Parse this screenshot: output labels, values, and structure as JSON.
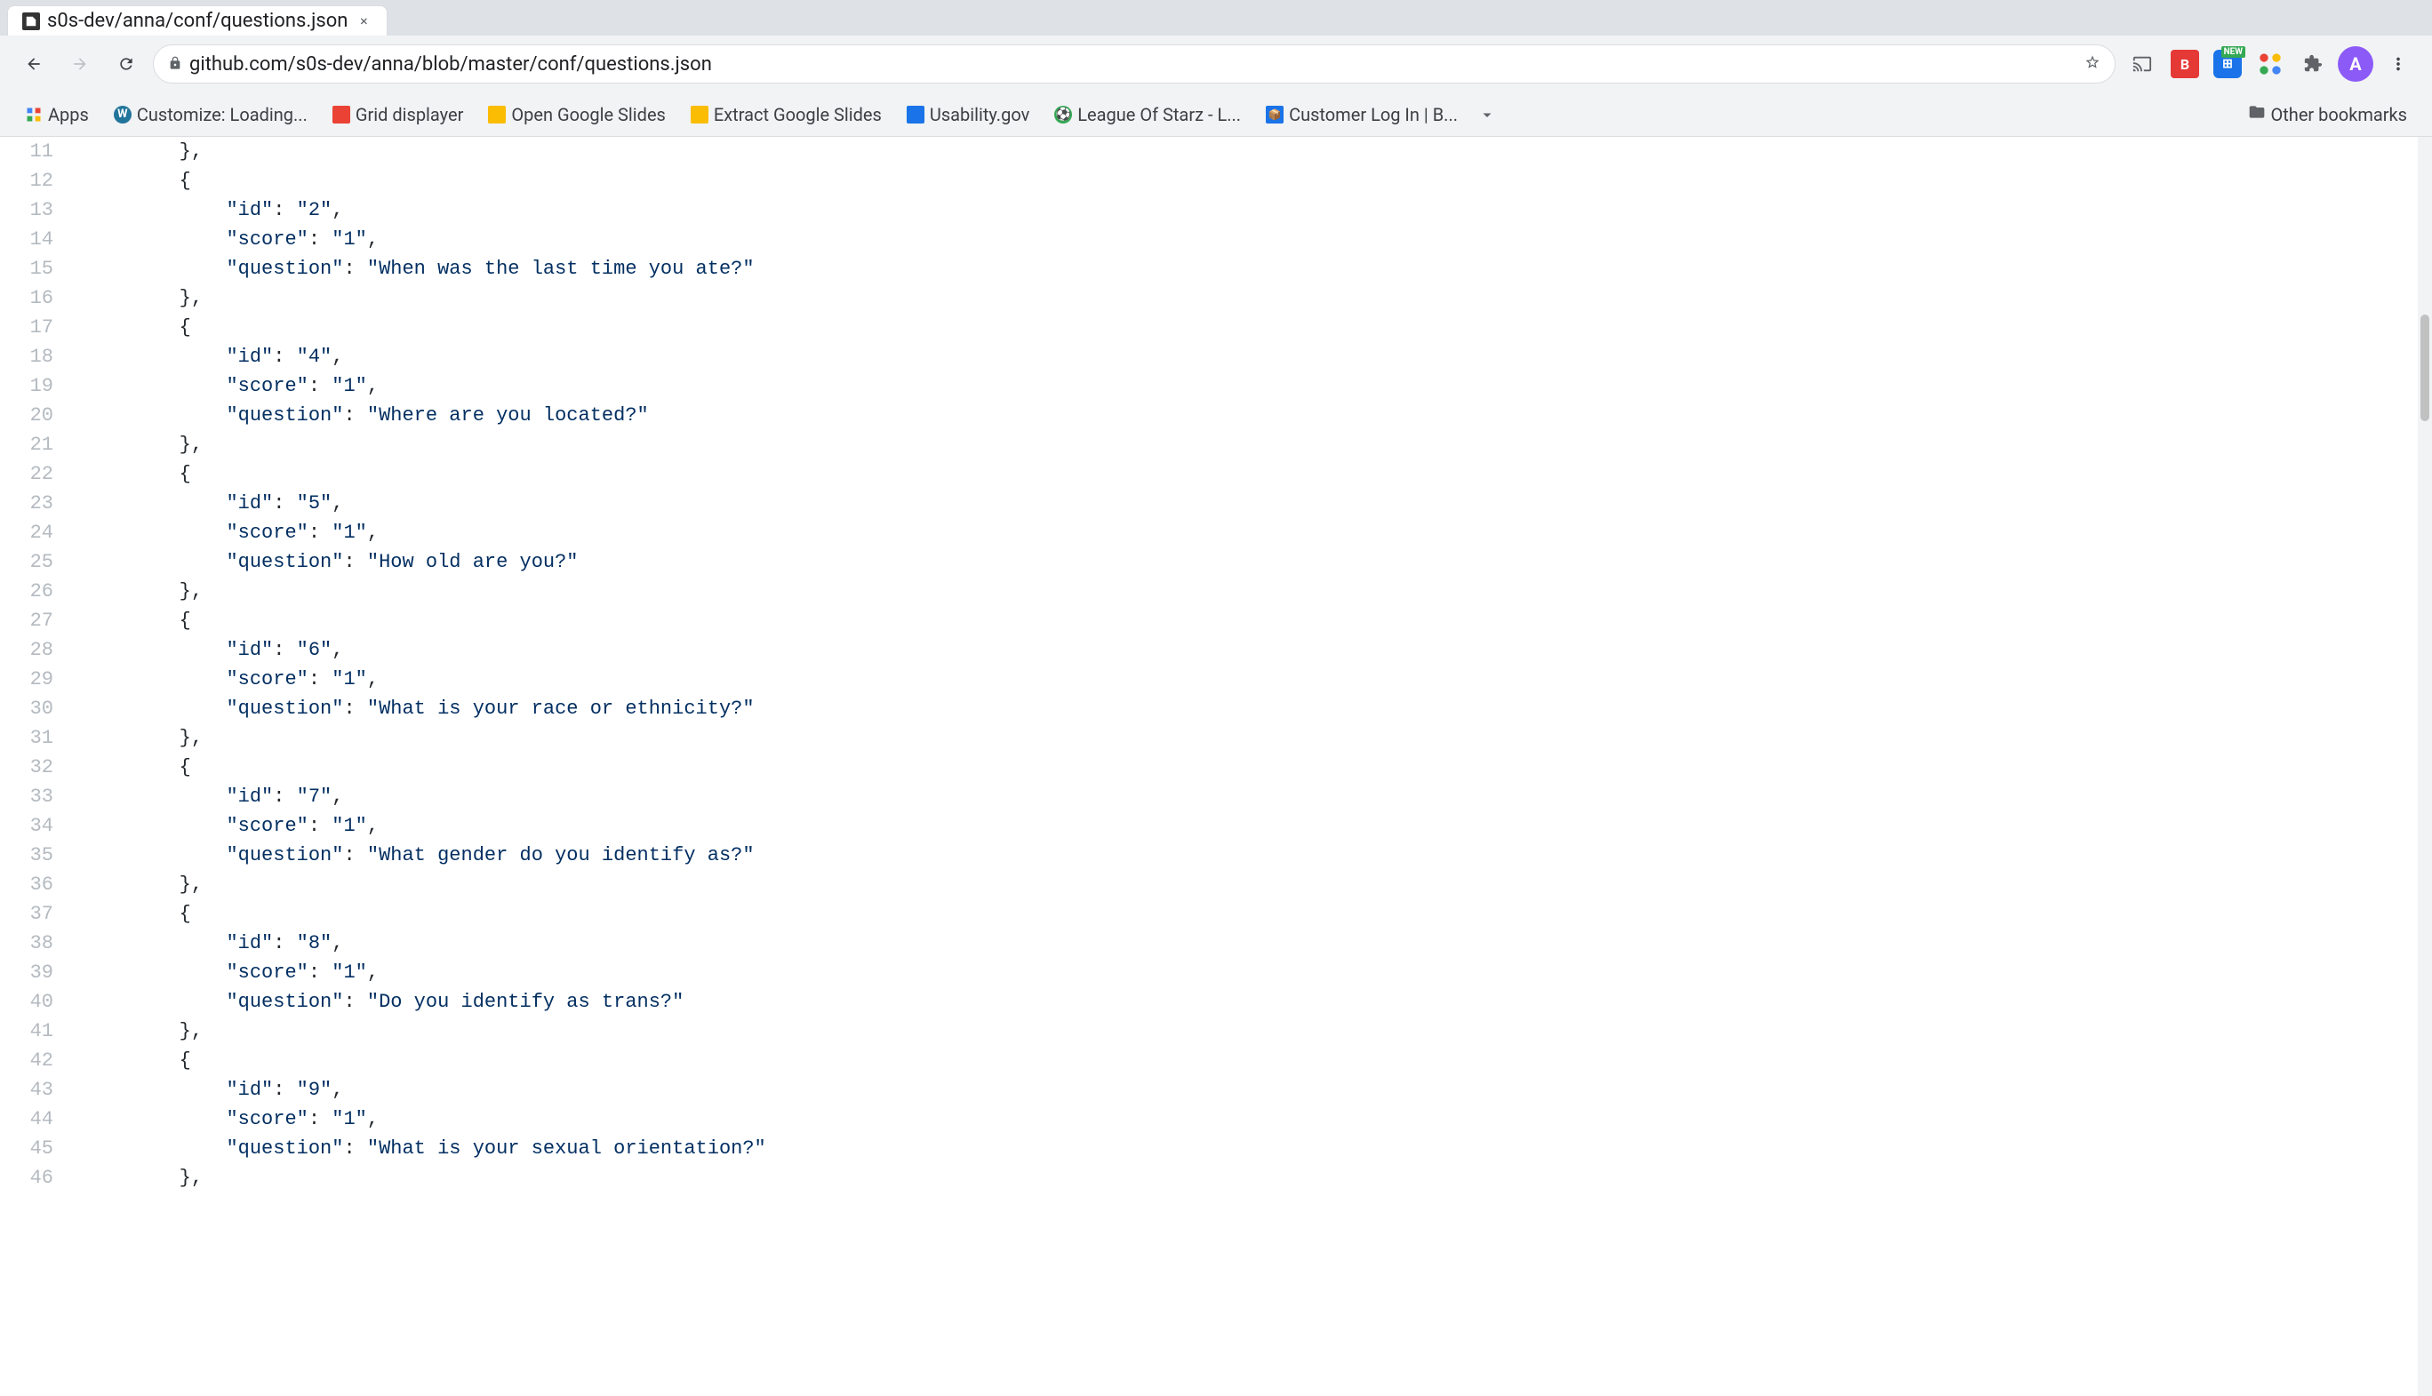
{
  "browser": {
    "tab": {
      "title": "s0s-dev/anna/conf/questions.json",
      "favicon": "📄"
    },
    "address": "github.com/s0s-dev/anna/blob/master/conf/questions.json",
    "nav": {
      "back_disabled": false,
      "forward_disabled": true,
      "reload": "↻"
    }
  },
  "bookmarks": [
    {
      "id": "apps",
      "label": "Apps",
      "favicon": "⊞",
      "color": "#4285f4"
    },
    {
      "id": "wordpress",
      "label": "Customize: Loading...",
      "favicon": "W",
      "color": "#21759b"
    },
    {
      "id": "grid",
      "label": "Grid displayer",
      "favicon": "🔴",
      "color": "#ea4335"
    },
    {
      "id": "google-slides",
      "label": "Open Google Slides",
      "favicon": "🟡",
      "color": "#fbbc04"
    },
    {
      "id": "extract-slides",
      "label": "Extract Google Slides",
      "favicon": "🟡",
      "color": "#fbbc04"
    },
    {
      "id": "usability",
      "label": "Usability.gov",
      "favicon": "🔵",
      "color": "#1a73e8"
    },
    {
      "id": "league",
      "label": "League Of Starz - L...",
      "favicon": "⚽",
      "color": "#34a853"
    },
    {
      "id": "customer",
      "label": "Customer Log In | B...",
      "favicon": "📦",
      "color": "#1a73e8"
    }
  ],
  "code": {
    "lines": [
      {
        "num": 11,
        "content": "        },"
      },
      {
        "num": 12,
        "content": "        {"
      },
      {
        "num": 13,
        "content": "            \"id\": \"2\","
      },
      {
        "num": 14,
        "content": "            \"score\": \"1\","
      },
      {
        "num": 15,
        "content": "            \"question\": \"When was the last time you ate?\""
      },
      {
        "num": 16,
        "content": "        },"
      },
      {
        "num": 17,
        "content": "        {"
      },
      {
        "num": 18,
        "content": "            \"id\": \"4\","
      },
      {
        "num": 19,
        "content": "            \"score\": \"1\","
      },
      {
        "num": 20,
        "content": "            \"question\": \"Where are you located?\""
      },
      {
        "num": 21,
        "content": "        },"
      },
      {
        "num": 22,
        "content": "        {"
      },
      {
        "num": 23,
        "content": "            \"id\": \"5\","
      },
      {
        "num": 24,
        "content": "            \"score\": \"1\","
      },
      {
        "num": 25,
        "content": "            \"question\": \"How old are you?\""
      },
      {
        "num": 26,
        "content": "        },"
      },
      {
        "num": 27,
        "content": "        {"
      },
      {
        "num": 28,
        "content": "            \"id\": \"6\","
      },
      {
        "num": 29,
        "content": "            \"score\": \"1\","
      },
      {
        "num": 30,
        "content": "            \"question\": \"What is your race or ethnicity?\""
      },
      {
        "num": 31,
        "content": "        },"
      },
      {
        "num": 32,
        "content": "        {"
      },
      {
        "num": 33,
        "content": "            \"id\": \"7\","
      },
      {
        "num": 34,
        "content": "            \"score\": \"1\","
      },
      {
        "num": 35,
        "content": "            \"question\": \"What gender do you identify as?\""
      },
      {
        "num": 36,
        "content": "        },"
      },
      {
        "num": 37,
        "content": "        {"
      },
      {
        "num": 38,
        "content": "            \"id\": \"8\","
      },
      {
        "num": 39,
        "content": "            \"score\": \"1\","
      },
      {
        "num": 40,
        "content": "            \"question\": \"Do you identify as trans?\""
      },
      {
        "num": 41,
        "content": "        },"
      },
      {
        "num": 42,
        "content": "        {"
      },
      {
        "num": 43,
        "content": "            \"id\": \"9\","
      },
      {
        "num": 44,
        "content": "            \"score\": \"1\","
      },
      {
        "num": 45,
        "content": "            \"question\": \"What is your sexual orientation?\""
      },
      {
        "num": 46,
        "content": "        },"
      }
    ]
  },
  "extensions": {
    "chromecast": "📺",
    "bitdefender": "B",
    "new_badge": "NEW",
    "profiles": "🎨",
    "extensions_icon": "🧩",
    "more_icon": "⋮"
  },
  "other_bookmarks_label": "Other bookmarks"
}
